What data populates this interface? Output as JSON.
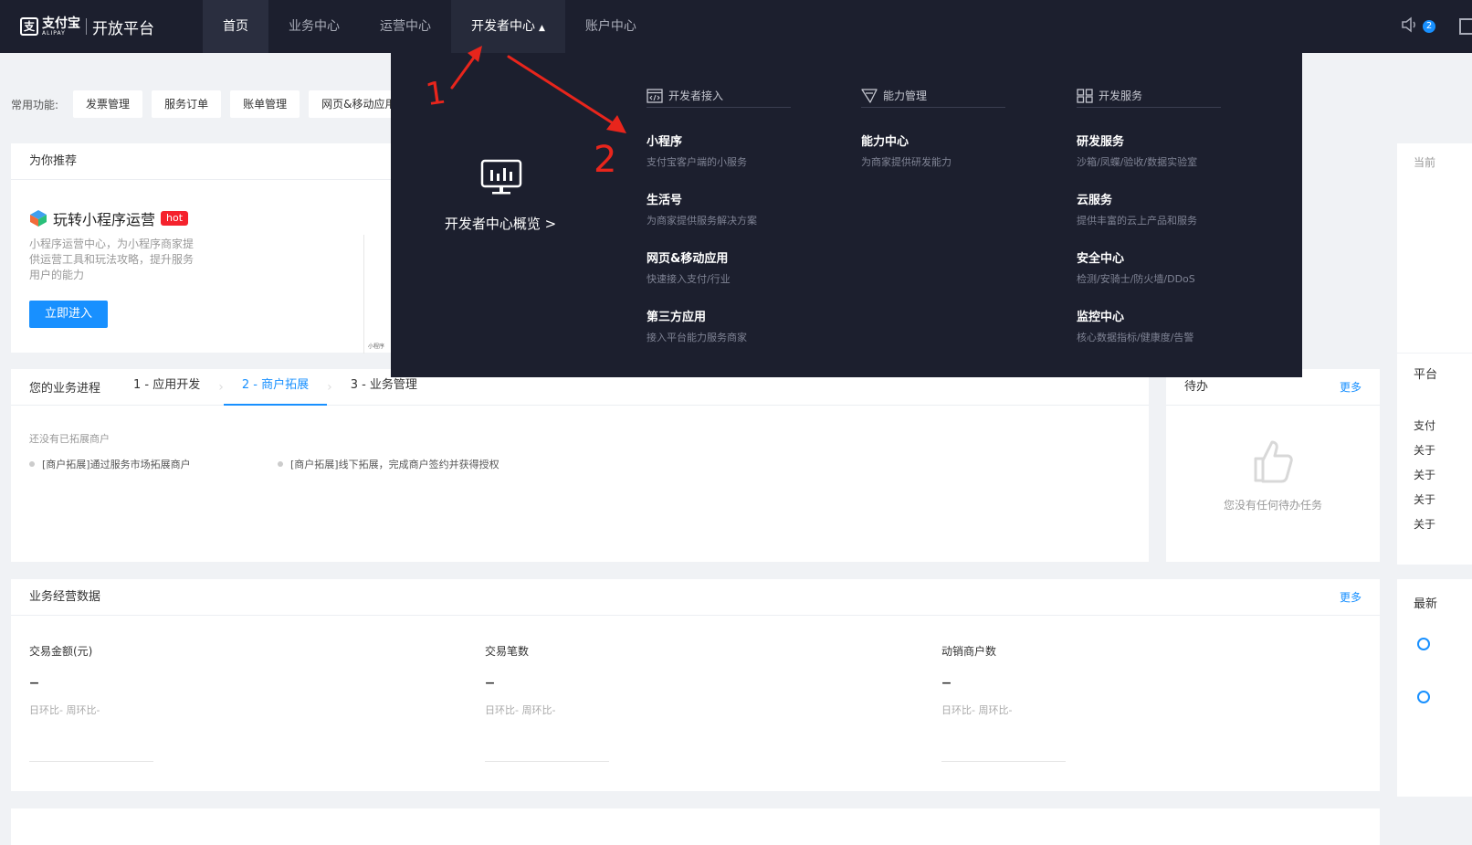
{
  "header": {
    "logo_brand": "支付宝",
    "logo_sub": "ALIPAY",
    "logo_title": "开放平台",
    "nav": [
      {
        "label": "首页"
      },
      {
        "label": "业务中心"
      },
      {
        "label": "运营中心"
      },
      {
        "label": "开发者中心"
      },
      {
        "label": "账户中心"
      }
    ],
    "notification_count": "2",
    "icons": [
      "speaker-icon",
      "doc-icon"
    ]
  },
  "quick": {
    "label": "常用功能:",
    "buttons": [
      "发票管理",
      "服务订单",
      "账单管理",
      "网页&移动应用"
    ]
  },
  "recommend": {
    "title": "为你推荐",
    "feature_title": "玩转小程序运营",
    "hot": "hot",
    "desc": "小程序运营中心，为小程序商家提供运营工具和玩法攻略，提升服务用户的能力",
    "button": "立即进入",
    "phone_caption": "小程序"
  },
  "progress": {
    "title": "您的业务进程",
    "steps": [
      "1 - 应用开发",
      "2 - 商户拓展",
      "3 - 业务管理"
    ],
    "active_step": 1,
    "empty": "还没有已拓展商户",
    "links": [
      "[商户拓展]通过服务市场拓展商户",
      "[商户拓展]线下拓展，完成商户签约并获得授权"
    ]
  },
  "todo": {
    "title": "待办",
    "more": "更多",
    "empty": "您没有任何待办任务"
  },
  "business": {
    "title": "业务经营数据",
    "more": "更多",
    "metrics": [
      {
        "label": "交易金额(元)",
        "value": "–",
        "comparison": "日环比-  周环比-"
      },
      {
        "label": "交易笔数",
        "value": "–",
        "comparison": "日环比-  周环比-"
      },
      {
        "label": "动销商户数",
        "value": "–",
        "comparison": "日环比-  周环比-"
      }
    ]
  },
  "right_col": {
    "top_label": "当前",
    "platform_label": "平台",
    "items": [
      "支付",
      "关于",
      "关于",
      "关于",
      "关于"
    ],
    "latest_label": "最新"
  },
  "dropdown": {
    "overview": "开发者中心概览 >",
    "columns": [
      {
        "heading": "开发者接入",
        "items": [
          {
            "title": "小程序",
            "desc": "支付宝客户端的小服务"
          },
          {
            "title": "生活号",
            "desc": "为商家提供服务解决方案"
          },
          {
            "title": "网页&移动应用",
            "desc": "快速接入支付/行业"
          },
          {
            "title": "第三方应用",
            "desc": "接入平台能力服务商家"
          }
        ]
      },
      {
        "heading": "能力管理",
        "items": [
          {
            "title": "能力中心",
            "desc": "为商家提供研发能力"
          }
        ]
      },
      {
        "heading": "开发服务",
        "items": [
          {
            "title": "研发服务",
            "desc": "沙箱/凤蝶/验收/数据实验室"
          },
          {
            "title": "云服务",
            "desc": "提供丰富的云上产品和服务"
          },
          {
            "title": "安全中心",
            "desc": "检测/安骑士/防火墙/DDoS"
          },
          {
            "title": "监控中心",
            "desc": "核心数据指标/健康度/告警"
          }
        ]
      }
    ]
  },
  "annotations": [
    "1",
    "2"
  ],
  "colors": {
    "nav_bg": "#1c1f2e",
    "accent": "#1890ff",
    "hot": "#f5222d",
    "annotation": "#e8251c"
  }
}
